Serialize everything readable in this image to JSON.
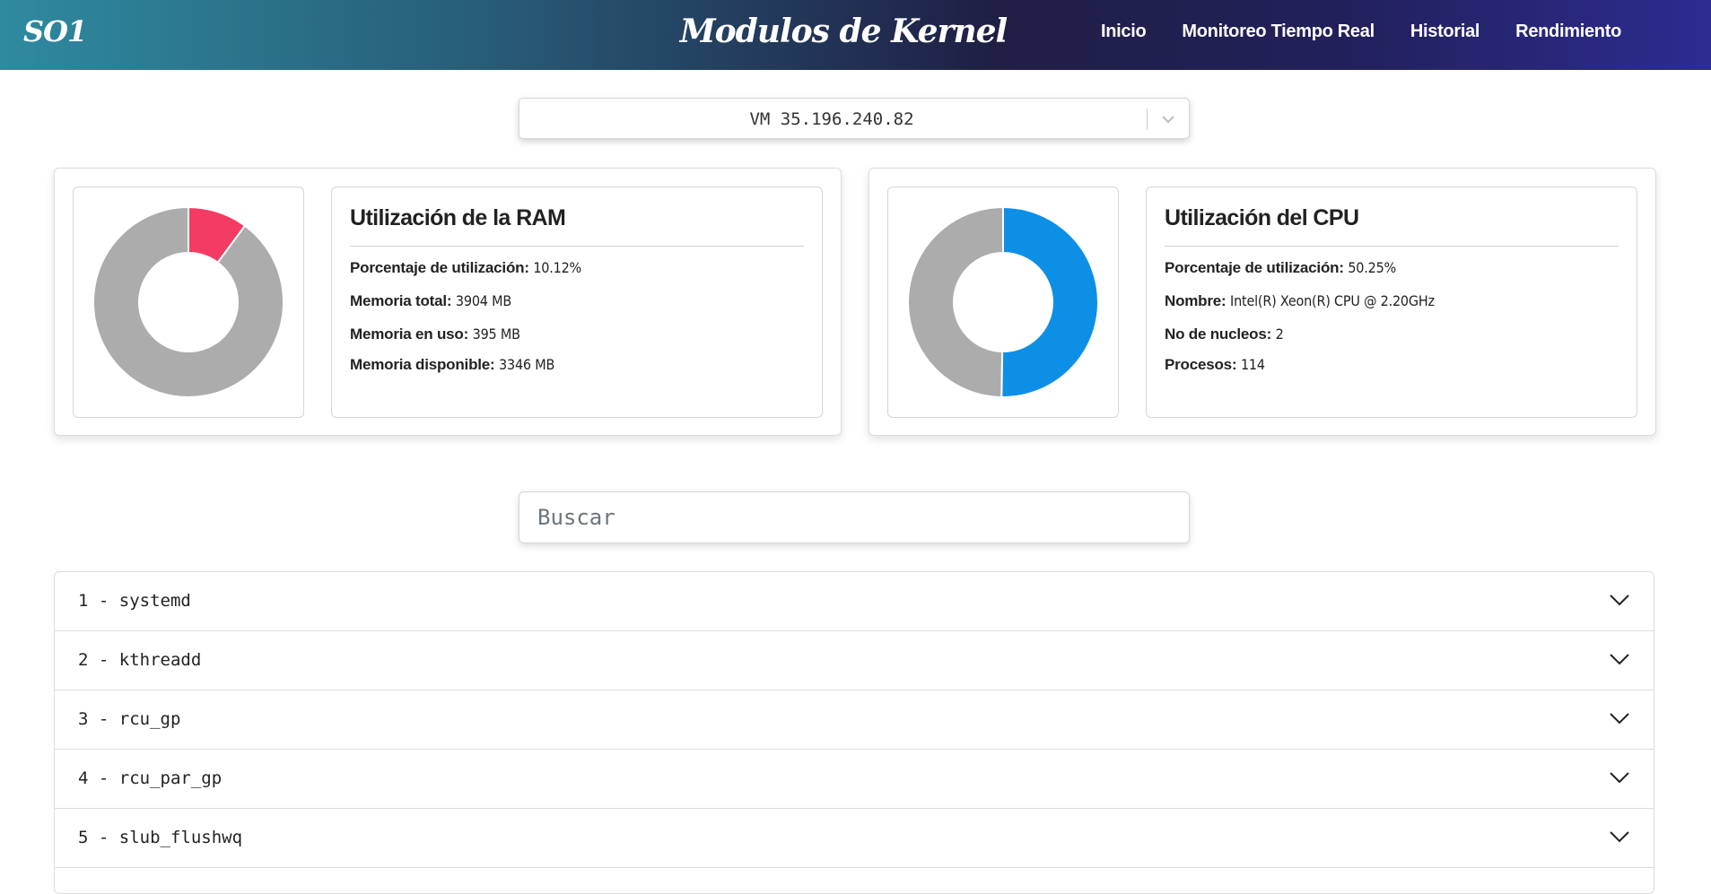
{
  "header": {
    "brand": "SO1",
    "title": "Modulos de Kernel",
    "nav": [
      {
        "label": "Inicio"
      },
      {
        "label": "Monitoreo Tiempo Real"
      },
      {
        "label": "Historial"
      },
      {
        "label": "Rendimiento"
      }
    ]
  },
  "vm_select": {
    "value": "VM 35.196.240.82",
    "icon": "chevron-down-icon"
  },
  "ram": {
    "title": "Utilización de la RAM",
    "percent_label": "Porcentaje de utilización:",
    "percent_value": "10.12%",
    "total_label": "Memoria total:",
    "total_value": "3904 MB",
    "used_label": "Memoria en uso:",
    "used_value": "395 MB",
    "available_label": "Memoria disponible:",
    "available_value": "3346 MB",
    "chart": {
      "used_fraction": 0.1012,
      "used_color": "#f43b64",
      "free_color": "#acacac"
    }
  },
  "cpu": {
    "title": "Utilización del CPU",
    "percent_label": "Porcentaje de utilización:",
    "percent_value": "50.25%",
    "name_label": "Nombre:",
    "name_value": "Intel(R) Xeon(R) CPU @ 2.20GHz",
    "cores_label": "No de nucleos:",
    "cores_value": "2",
    "processes_label": "Procesos:",
    "processes_value": "114",
    "chart": {
      "used_fraction": 0.5025,
      "used_color": "#0d8fe6",
      "free_color": "#acacac"
    }
  },
  "search": {
    "placeholder": "Buscar"
  },
  "processes": [
    {
      "label": "1 - systemd"
    },
    {
      "label": "2 - kthreadd"
    },
    {
      "label": "3 - rcu_gp"
    },
    {
      "label": "4 - rcu_par_gp"
    },
    {
      "label": "5 - slub_flushwq"
    }
  ]
}
